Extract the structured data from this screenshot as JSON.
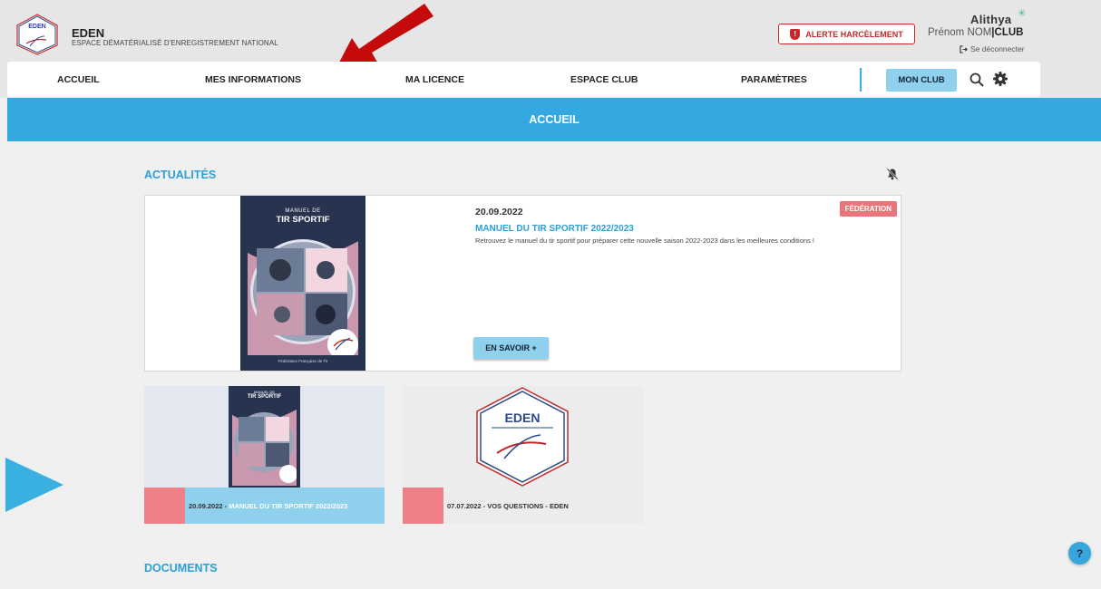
{
  "brand": {
    "name": "EDEN",
    "subtitle": "ESPACE DÉMATÉRIALISÉ D'ENREGISTREMENT NATIONAL",
    "logo_text": "EDEN"
  },
  "header": {
    "alert_label": "ALERTE HARCÈLEMENT",
    "company": "Alithya",
    "user_first": "Prénom NOM",
    "user_sep": "|",
    "user_club": "CLUB",
    "logout_label": "Se déconnecter"
  },
  "nav": {
    "items": [
      "ACCUEIL",
      "MES INFORMATIONS",
      "MA LICENCE",
      "ESPACE CLUB",
      "PARAMÈTRES"
    ],
    "club_button": "MON CLUB"
  },
  "banner": {
    "title": "ACCUEIL"
  },
  "news": {
    "section_title": "ACTUALITÉS",
    "featured": {
      "date": "20.09.2022",
      "tag": "FÉDÉRATION",
      "title": "MANUEL DU TIR SPORTIF 2022/2023",
      "description": "Retrouvez le manuel du tir sportif pour préparer cette nouvelle saison 2022-2023 dans les meilleures conditions !",
      "button": "EN SAVOIR +",
      "cover_small": "MANUEL DE",
      "cover_title": "TIR SPORTIF",
      "cover_footer": "Fédération Française de Tir"
    },
    "tiles": [
      {
        "date": "20.09.2022 - ",
        "title": "MANUEL DU TIR SPORTIF 2022/2023",
        "cover_small": "MANUEL DE",
        "cover_title": "TIR SPORTIF"
      },
      {
        "label": "07.07.2022 - VOS QUESTIONS - EDEN",
        "logo_text": "EDEN"
      }
    ]
  },
  "documents": {
    "section_title": "DOCUMENTS"
  },
  "help": {
    "label": "?"
  },
  "colors": {
    "primary": "#35a8e0",
    "accent_red": "#c62828",
    "tag_pink": "#e9757b",
    "light_blue": "#8fd0ec"
  }
}
